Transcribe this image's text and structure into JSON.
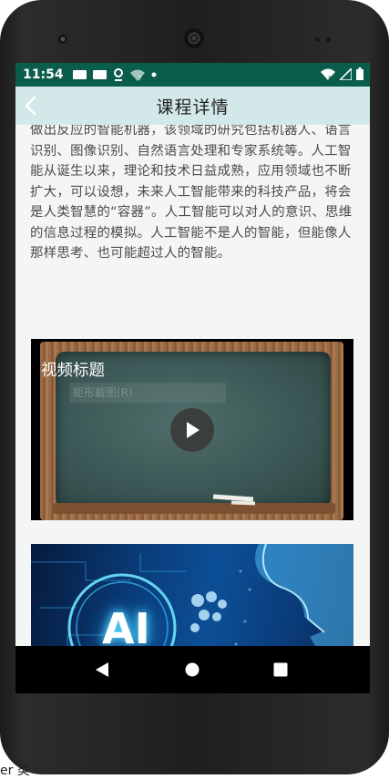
{
  "status_bar": {
    "time": "11:54",
    "icons": [
      "notification-card-icon",
      "notification-card-icon",
      "location-icon",
      "wifi-question-icon",
      "dot-icon"
    ],
    "right_icons": [
      "wifi-x-icon",
      "signal-icon",
      "battery-icon"
    ],
    "color": "#0b5d4b"
  },
  "header": {
    "title": "课程详情",
    "back_icon": "chevron-left-icon",
    "color": "#d3e9e9"
  },
  "article": {
    "text": "做出反应的智能机器，该领域的研究包括机器人、语言识别、图像识别、自然语言处理和专家系统等。人工智能从诞生以来，理论和技术日益成熟，应用领域也不断扩大，可以设想，未来人工智能带来的科技产品，将会是人类智慧的“容器”。人工智能可以对人的意识、思维的信息过程的模拟。人工智能不是人的智能，但能像人那样思考、也可能超过人的智能。"
  },
  "video": {
    "title": "视频标题",
    "overlay_label": "矩形截图(R)",
    "play_icon": "play-icon"
  },
  "image": {
    "label": "AI"
  },
  "nav": {
    "back_icon": "triangle-back-icon",
    "home_icon": "circle-home-icon",
    "recents_icon": "square-recents-icon"
  },
  "bottom_text": "er 类"
}
